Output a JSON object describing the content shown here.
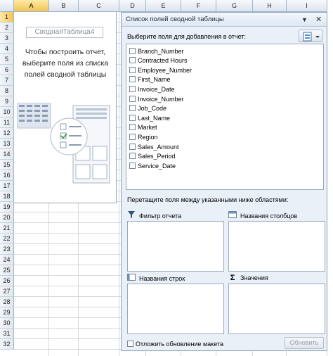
{
  "sheet": {
    "columns": [
      "A",
      "B",
      "C",
      "D",
      "E",
      "F",
      "G",
      "H",
      "I"
    ],
    "rows": [
      "1",
      "2",
      "3",
      "4",
      "5",
      "6",
      "7",
      "8",
      "9",
      "10",
      "11",
      "12",
      "13",
      "14",
      "15",
      "16",
      "17",
      "18",
      "19",
      "20",
      "21",
      "22",
      "23",
      "24",
      "25",
      "26",
      "27",
      "28",
      "29",
      "30",
      "31",
      "32"
    ],
    "selected_column": "A",
    "selected_row": "1"
  },
  "pivot": {
    "name": "СводнаяТаблица4",
    "hint": "Чтобы построить отчет, выберите поля из списка полей сводной таблицы"
  },
  "pane": {
    "title": "Список полей сводной таблицы",
    "dropdown_icon": "chevron-down-icon",
    "close_icon": "close-icon",
    "choose_label": "Выберите поля для добавления в отчет:",
    "fields": [
      "Branch_Number",
      "Contracted Hours",
      "Employee_Number",
      "First_Name",
      "Invoice_Date",
      "Invoice_Number",
      "Job_Code",
      "Last_Name",
      "Market",
      "Region",
      "Sales_Amount",
      "Sales_Period",
      "Service_Date"
    ],
    "drag_label": "Перетащите поля между указанными ниже областями:",
    "zones": {
      "filter": "Фильтр отчета",
      "columns": "Названия столбцов",
      "rows": "Названия строк",
      "values": "Значения"
    },
    "defer_label": "Отложить обновление макета",
    "update_button": "Обновить"
  },
  "colors": {
    "pane_bg": "#eaf0f8",
    "header_highlight": "#f3c552"
  }
}
